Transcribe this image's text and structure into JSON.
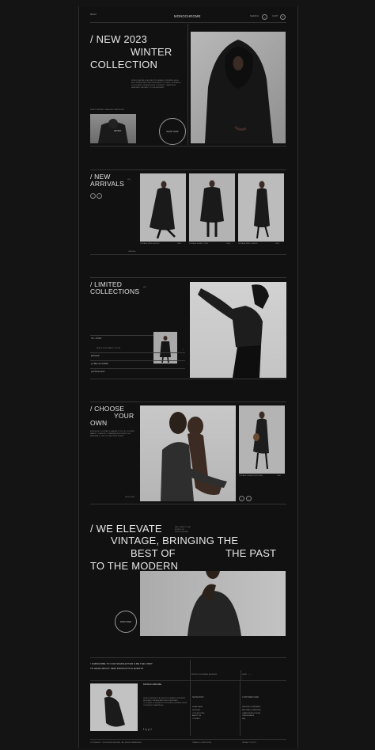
{
  "header": {
    "menu_label": "MENU",
    "brand": "MONOCHROME",
    "search_label": "SEARCH",
    "cart_label": "CART",
    "cart_count": "0"
  },
  "hero": {
    "title_line1": "/ NEW 2023",
    "title_line2": "WINTER",
    "title_line3": "COLLECTION",
    "description": "MONOCHROME IS A LIFESTYLE BRAND OFFERING HIGH END VINTAGE AND NEW DESIGNER CLOTHING. OUR AIM IS TO ELEVATE VINTAGE FROM IT'S RETRO TRAPPINGS, BRINGING THE BEST TO THE MODERN.",
    "thumb_caption": "MONOCHROME 5 SEASONS 3 ARCHIVES",
    "shop_button": "SHOP NOW"
  },
  "new_arrivals": {
    "title_line1": "/ NEW",
    "title_line2": "ARRIVALS",
    "count": "(01)",
    "products": [
      {
        "name": "VINTAGE JENN JACKET",
        "price": "£000"
      },
      {
        "name": "VINTAGE KERRY COAT",
        "price": "£000"
      },
      {
        "name": "VINTAGE EMILY DRESS",
        "price": "£000"
      }
    ],
    "view_all": "VIEW ALL"
  },
  "limited": {
    "title_line1": "/ LIMITED",
    "title_line2": "COLLECTIONS",
    "count": "(02)",
    "items": [
      {
        "label": "'00 - 2010S",
        "sub": "BLACK IS MY HAPPY COLOR"
      },
      {
        "label": "WINGED"
      },
      {
        "label": "LA BELLE FEMME"
      },
      {
        "label": "VINTAGE EDIT"
      }
    ]
  },
  "choose": {
    "title_line1": "/ CHOOSE",
    "title_line2": "YOUR",
    "title_line3": "OWN",
    "description": "EPISODES TO DETAIL IS LARGELY OUT OF CLOTHES, FABRIC, COMFORT, COMBINING A TECHNOLOGY MATERIALS: THE COLLAB FROM STRIKE.",
    "shop_now": "SHOP NOW",
    "product_name": "VINTAGE DRAWSTRING BAG",
    "product_price": "£000"
  },
  "elevate": {
    "line1": "/ WE ELEVATE",
    "side_note": "WELCOME TO THE WORLD OF MONOCHROME",
    "line2": "VINTAGE, BRINGING THE",
    "line3a": "BEST OF",
    "line3b": "THE PAST",
    "line4": "TO THE MODERN",
    "discover": "DISCOVER"
  },
  "newsletter": {
    "heading_line1": "/ SUBSCRIBE TO OUR NEWSLETTER & BE THE FIRST",
    "heading_line2": "TO HEAR ABOUT NEW PRODUCTS & EVENTS",
    "email_placeholder": "ENTER YOUR EMAIL ADDRESS",
    "send_label": "SEND"
  },
  "footer": {
    "brand": "MONOCHROME",
    "about": "MONOCHROME IS A LIFESTYLE BRAND OFFERING HIGH END VINTAGE AND NEW DESIGNER CLOTHING. OUR AIM IS TO ELEVATE VINTAGE FROM IT'S RETRO TRAPPINGS.",
    "col1_title": "NAVIGATION",
    "col1": [
      "HOME PAGE",
      "SHOP ALL",
      "COLLECTIONS",
      "ABOUT US",
      "CONTACT"
    ],
    "col2_title": "CUSTOMER CARE",
    "col2": [
      "SHIPPING & PAYMENT",
      "RETURNS & REFUNDS",
      "CARE INSTRUCTIONS",
      "OFFER SALES",
      "FAQ"
    ],
    "copyright": "COPYRIGHT © 2023 MONOCHROME · ALL RIGHTS RESERVED",
    "terms": "TERMS & CONDITIONS",
    "privacy": "PRIVACY POLICY"
  },
  "colors": {
    "background": "#141414",
    "page": "#111111",
    "text": "#e8e8e8",
    "rule": "#333333"
  }
}
